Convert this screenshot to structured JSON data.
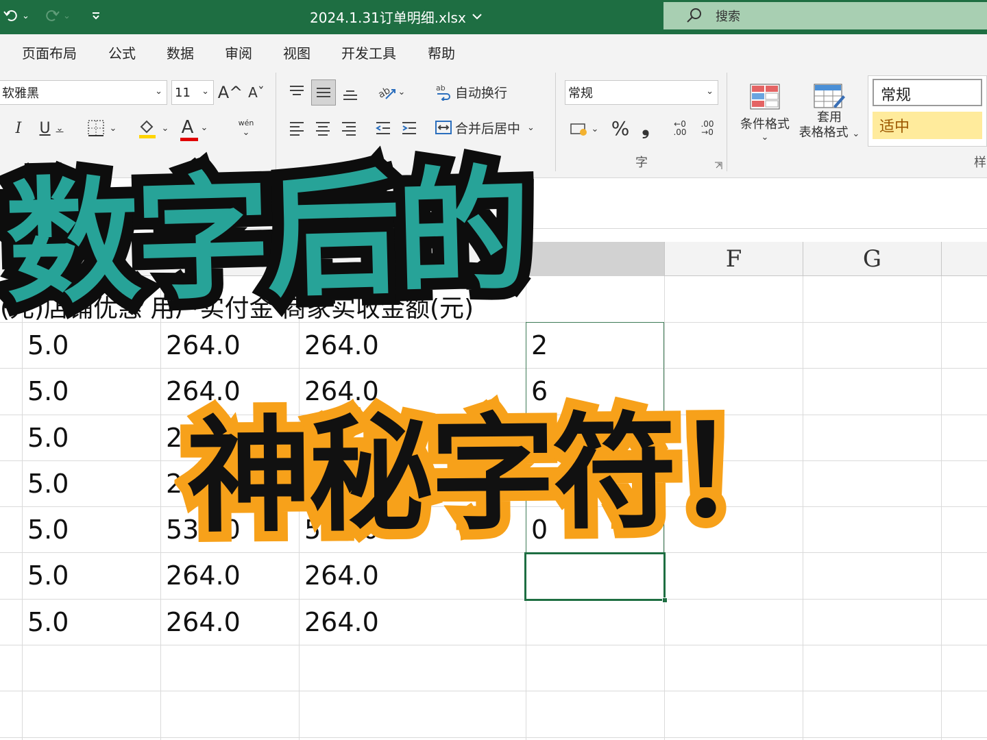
{
  "titlebar": {
    "filename": "2024.1.31订单明细.xlsx",
    "search_placeholder": "搜索",
    "undo_icon": "undo-icon",
    "redo_icon": "redo-icon",
    "customize_icon": "customize-quick-access-icon",
    "search_icon": "search-icon",
    "colors": {
      "bar": "#1e6e42",
      "search_box": "#a8cfb2"
    }
  },
  "menu": {
    "tabs": [
      "页面布局",
      "公式",
      "数据",
      "审阅",
      "视图",
      "开发工具",
      "帮助"
    ]
  },
  "ribbon": {
    "font_name": "软雅黑",
    "font_size": "11",
    "increase_font": "A^",
    "decrease_font": "Aˇ",
    "italic": "I",
    "underline": "U",
    "font_color_letter": "A",
    "phonetic_label": "wén",
    "wrap_text": "自动换行",
    "merge_center": "合并后居中",
    "number_format": "常规",
    "percent": "%",
    "comma": "❟",
    "inc_decimal": "←0 .00",
    "dec_decimal": ".00 →0",
    "cond_format": "条件格式",
    "table_format_1": "套用",
    "table_format_2": "表格格式",
    "style_normal": "常规",
    "style_neutral": "适中",
    "group_label_styles": "样",
    "group_label_number": "字"
  },
  "sheet": {
    "columns_visible": [
      "F",
      "G"
    ],
    "header_row_text": "(元)店铺优惠 用户实付金 商家实收金额(元)",
    "rows": [
      {
        "a": "5.0",
        "b": "264.0",
        "c": "264.0",
        "d": "2"
      },
      {
        "a": "5.0",
        "b": "264.0",
        "c": "264.0",
        "d": "6"
      },
      {
        "a": "5.0",
        "b": "264.0",
        "c": "264.0",
        "d": ""
      },
      {
        "a": "5.0",
        "b": "264.0",
        "c": "264.0",
        "d": ""
      },
      {
        "a": "5.0",
        "b": "538.0",
        "c": "538.0",
        "d": "0"
      },
      {
        "a": "5.0",
        "b": "264.0",
        "c": "264.0",
        "d": ""
      },
      {
        "a": "5.0",
        "b": "264.0",
        "c": "264.0",
        "d": ""
      }
    ]
  },
  "overlay": {
    "line1": "数字后的",
    "line2": "神秘字符！",
    "line1_fill": "#27a398",
    "line1_outline": "#0d0d0d",
    "line2_fill": "#111111",
    "line2_outline": "#f7a11a"
  }
}
